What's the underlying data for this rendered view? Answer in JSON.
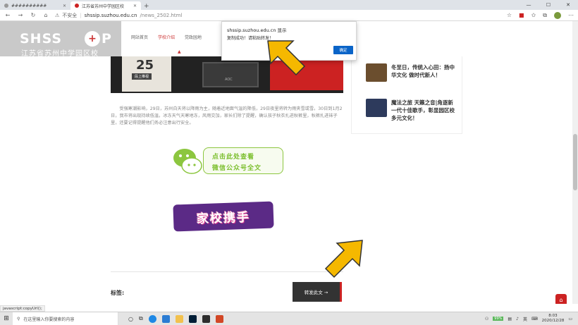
{
  "browser": {
    "tabs": [
      {
        "title": "##########",
        "active": false
      },
      {
        "title": "江苏省苏州中学园区校",
        "active": true
      }
    ],
    "address": {
      "security": "不安全",
      "host": "shssip.suzhou.edu.cn",
      "path": "/news_2502.html"
    }
  },
  "site": {
    "logo_en": "SHSS",
    "logo_cross": "+",
    "logo_en_tail": "P",
    "logo_cn": "江苏省苏州中学园区校",
    "nav": [
      "网站首页",
      "学校介绍",
      "党政园地"
    ],
    "active_nav_index": 1
  },
  "hero": {
    "calendar_number": "25",
    "calendar_tag": "段上推视",
    "monitor_brand": "AOC"
  },
  "article": {
    "paragraph": "受强寒潮影响，29日，苏州白天将以降雨为主，随着近地面气温的降低，29日夜里将转为雨夹雪或雪。30日到1月2日，我市将出现持续低温，冰冻天气天寒地冻，风雨交加，家长们除了提醒，确认孩子秋衣扎进秋裤里，秋裤扎进袜子里，还要记得提醒他们务必注意出行安全。"
  },
  "banners": {
    "wechat_line1": "点击此处查看",
    "wechat_line2": "微信公众号全文",
    "jiaxiao": "家校携手"
  },
  "footer_area": {
    "tags_label": "标签:",
    "repost_button": "转发此文 →"
  },
  "sidebar": {
    "items": [
      {
        "title": "冬至日，传统入心田：扬中华文化 做时代新人！",
        "thumb_color": "#6b4e2e"
      },
      {
        "title": "魔法之旅 天籁之音|角逐新一代十佳歌手，彰显园区校多元文化！",
        "thumb_color": "#2d3a5c"
      }
    ]
  },
  "alert": {
    "title": "shssip.suzhou.edu.cn 显示",
    "message": "复制成功！请粘贴转发！",
    "ok_label": "确定"
  },
  "status_text": "javascript:copyUrl();",
  "taskbar": {
    "search_placeholder": "在这里输入你要搜索的内容",
    "battery": "99%",
    "ime": "英",
    "time": "8:03",
    "date": "2020/12/28"
  },
  "colors": {
    "accent_red": "#cc2222",
    "wechat_green": "#7cbf2e",
    "alert_blue": "#0a64c8",
    "arrow_yellow": "#f5b800"
  }
}
